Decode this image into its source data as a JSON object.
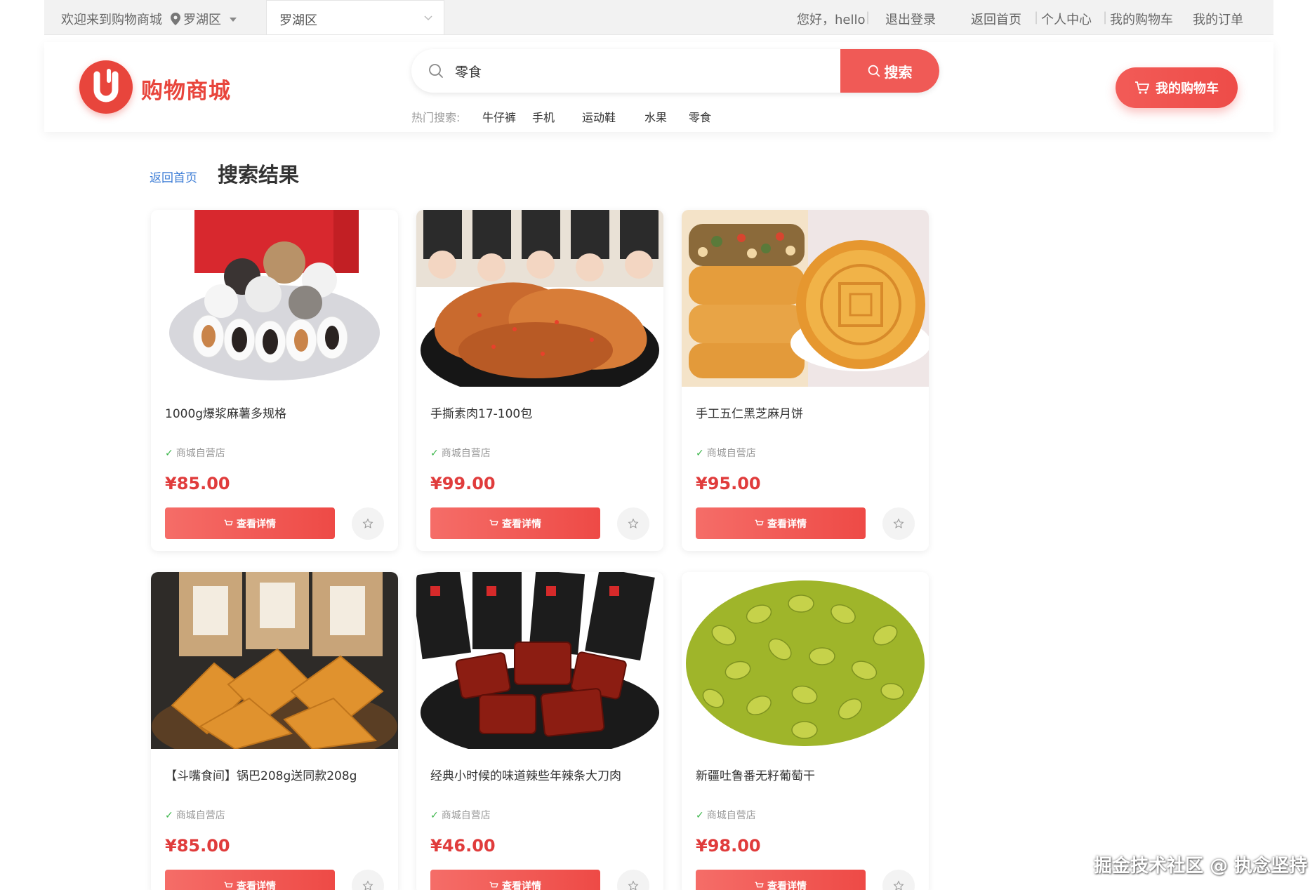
{
  "topbar": {
    "welcome": "欢迎来到购物商城",
    "location": "罗湖区",
    "location_select": "罗湖区",
    "greeting": "您好，hello",
    "logout": "退出登录",
    "home": "返回首页",
    "profile": "个人中心",
    "cart": "我的购物车",
    "orders": "我的订单"
  },
  "header": {
    "logo_text": "购物商城",
    "search_value": "零食",
    "search_button": "搜索",
    "hot_label": "热门搜索:",
    "hot_keywords": [
      "牛仔裤",
      "手机",
      "运动鞋",
      "水果",
      "零食"
    ],
    "cart_button": "我的购物车"
  },
  "breadcrumb": {
    "back": "返回首页",
    "title": "搜索结果"
  },
  "products": [
    {
      "name": "1000g爆浆麻薯多规格",
      "shop": "商城自营店",
      "price": "¥85.00",
      "button": "查看详情"
    },
    {
      "name": "手撕素肉17-100包",
      "shop": "商城自营店",
      "price": "¥99.00",
      "button": "查看详情"
    },
    {
      "name": "手工五仁黑芝麻月饼",
      "shop": "商城自营店",
      "price": "¥95.00",
      "button": "查看详情"
    },
    {
      "name": "【斗嘴食间】锅巴208g送同款208g",
      "shop": "商城自营店",
      "price": "¥85.00",
      "button": "查看详情"
    },
    {
      "name": "经典小时候的味道辣些年辣条大刀肉",
      "shop": "商城自营店",
      "price": "¥46.00",
      "button": "查看详情"
    },
    {
      "name": "新疆吐鲁番无籽葡萄干",
      "shop": "商城自营店",
      "price": "¥98.00",
      "button": "查看详情"
    }
  ],
  "watermark": "掘金技术社区 @ 执念坚持",
  "colors": {
    "accent": "#f05a56",
    "price": "#e03c3c",
    "link": "#3a7bd5",
    "check": "#3bb54a"
  }
}
